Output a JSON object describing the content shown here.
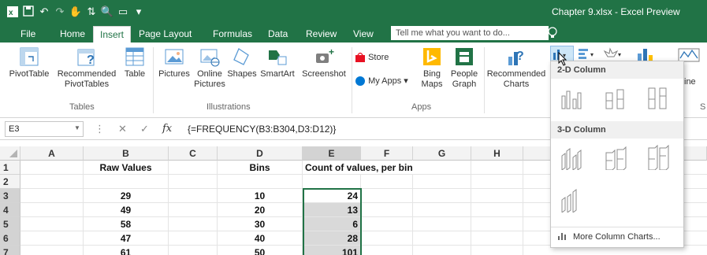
{
  "window": {
    "title": "Chapter 9.xlsx - Excel Preview"
  },
  "tabs": [
    {
      "label": "File"
    },
    {
      "label": "Home"
    },
    {
      "label": "Insert"
    },
    {
      "label": "Page Layout"
    },
    {
      "label": "Formulas"
    },
    {
      "label": "Data"
    },
    {
      "label": "Review"
    },
    {
      "label": "View"
    }
  ],
  "tellme": {
    "placeholder": "Tell me what you want to do..."
  },
  "ribbon": {
    "tables": {
      "pivottable": "PivotTable",
      "recommended_pivot": "Recommended PivotTables",
      "table": "Table",
      "group": "Tables"
    },
    "illustrations": {
      "pictures": "Pictures",
      "online_pictures": "Online Pictures",
      "shapes": "Shapes",
      "smartart": "SmartArt",
      "screenshot": "Screenshot",
      "group": "Illustrations"
    },
    "apps": {
      "store": "Store",
      "myapps": "My Apps",
      "bing_maps": "Bing Maps",
      "people_graph": "People Graph",
      "group": "Apps"
    },
    "charts": {
      "recommended": "Recommended Charts",
      "line": "ine",
      "extra": "S"
    }
  },
  "formula_bar": {
    "namebox": "E3",
    "fx": "fx",
    "formula": "{=FREQUENCY(B3:B304,D3:D12)}"
  },
  "grid": {
    "columns": [
      "A",
      "B",
      "C",
      "D",
      "E",
      "F",
      "G",
      "H"
    ],
    "rows": [
      "1",
      "2",
      "3",
      "4",
      "5",
      "6",
      "7"
    ],
    "b1": "Raw Values",
    "d1": "Bins",
    "e1": "Count of values, per bin",
    "b_values": [
      "29",
      "49",
      "58",
      "47",
      "61"
    ],
    "d_values": [
      "10",
      "20",
      "30",
      "40",
      "50"
    ],
    "e_values": [
      "24",
      "13",
      "6",
      "28",
      "101"
    ]
  },
  "dropdown": {
    "section_2d": "2-D Column",
    "section_3d": "3-D Column",
    "more": "More Column Charts..."
  },
  "colors": {
    "excel_green": "#217346",
    "selection_fill": "#d9d9d9"
  }
}
